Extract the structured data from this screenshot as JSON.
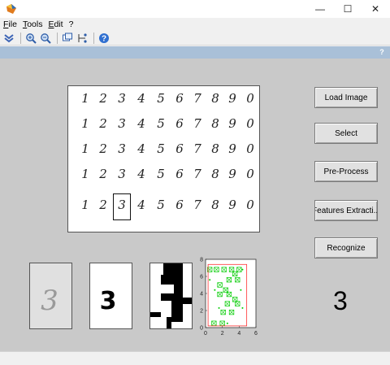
{
  "window": {
    "title": "",
    "minimize_glyph": "—",
    "maximize_glyph": "☐",
    "close_glyph": "✕",
    "app_icon": "matlab-figure-icon"
  },
  "menu": [
    "File",
    "Tools",
    "Edit",
    "?"
  ],
  "toolbar": {
    "icons": [
      "dock-icon",
      "zoom-in-icon",
      "zoom-out-icon",
      "link-plot-icon",
      "data-cursor-icon",
      "help-icon"
    ]
  },
  "helpbar": {
    "label": "?"
  },
  "digit_grid": {
    "rows": [
      [
        "1",
        "2",
        "3",
        "4",
        "5",
        "6",
        "7",
        "8",
        "9",
        "0"
      ],
      [
        "1",
        "2",
        "3",
        "4",
        "5",
        "6",
        "7",
        "8",
        "9",
        "0"
      ],
      [
        "1",
        "2",
        "3",
        "4",
        "5",
        "6",
        "7",
        "8",
        "9",
        "0"
      ],
      [
        "1",
        "2",
        "3",
        "4",
        "5",
        "6",
        "7",
        "8",
        "9",
        "0"
      ],
      [
        "1",
        "2",
        "3",
        "4",
        "5",
        "6",
        "7",
        "8",
        "9",
        "0"
      ]
    ]
  },
  "buttons": {
    "load_image": "Load Image",
    "select": "Select",
    "pre_process": "Pre-Process",
    "features_extraction": "Features Extracti...",
    "recognize": "Recognize"
  },
  "thumbnails": {
    "grayscale_digit": "3",
    "binary_digit": "3"
  },
  "chart_data": {
    "type": "scatter",
    "title": "",
    "xlabel": "",
    "ylabel": "",
    "xlim": [
      0,
      6
    ],
    "ylim": [
      0,
      8
    ],
    "xticks": [
      "0",
      "2",
      "4",
      "6"
    ],
    "yticks": [
      "0",
      "2",
      "4",
      "6",
      "8"
    ],
    "grid": false,
    "series": [
      {
        "name": "",
        "marker": "box-x",
        "color": "#00cc00",
        "points": [
          [
            0.5,
            6.8
          ],
          [
            1.3,
            6.8
          ],
          [
            2.2,
            6.8
          ],
          [
            3.1,
            6.8
          ],
          [
            4.0,
            6.8
          ],
          [
            3.5,
            6.3
          ],
          [
            2.8,
            5.6
          ],
          [
            3.8,
            5.6
          ],
          [
            1.7,
            5.0
          ],
          [
            2.4,
            4.4
          ],
          [
            1.7,
            3.9
          ],
          [
            2.8,
            3.9
          ],
          [
            3.5,
            3.3
          ],
          [
            2.6,
            2.8
          ],
          [
            3.8,
            2.8
          ],
          [
            2.1,
            1.8
          ],
          [
            3.1,
            1.8
          ],
          [
            1.0,
            0.5
          ],
          [
            2.0,
            0.5
          ]
        ]
      },
      {
        "name": "",
        "marker": "dot",
        "color": "#00cc00",
        "points": [
          [
            0.5,
            5.6
          ],
          [
            4.4,
            6.8
          ],
          [
            4.2,
            4.4
          ],
          [
            1.1,
            4.4
          ],
          [
            4.4,
            2.3
          ],
          [
            1.6,
            2.3
          ],
          [
            2.6,
            0.5
          ]
        ]
      },
      {
        "name": "",
        "marker": "rect",
        "color": "#ff3333",
        "rect": [
          0.3,
          0.2,
          4.9,
          7.4
        ]
      }
    ]
  },
  "result": {
    "value": "3"
  }
}
